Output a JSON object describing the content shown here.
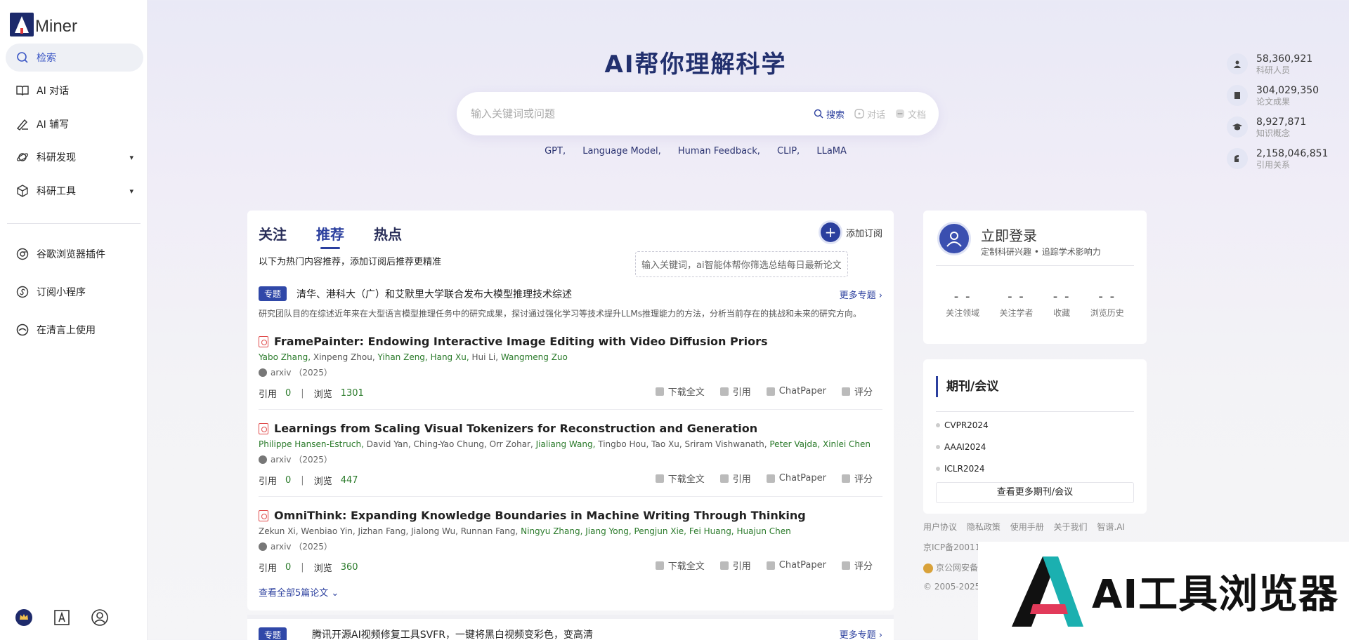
{
  "app": {
    "logo_text": "Miner"
  },
  "sidebar": {
    "items": [
      {
        "label": "检索"
      },
      {
        "label": "AI 对话"
      },
      {
        "label": "AI 辅写"
      },
      {
        "label": "科研发现"
      },
      {
        "label": "科研工具"
      },
      {
        "label": "谷歌浏览器插件"
      },
      {
        "label": "订阅小程序"
      },
      {
        "label": "在清言上使用"
      }
    ]
  },
  "hero": {
    "title": "AI帮你理解科学",
    "search_placeholder": "输入关键词或问题",
    "modes": {
      "search": "搜索",
      "chat": "对话",
      "doc": "文档"
    },
    "tags": [
      "GPT,",
      "Language Model,",
      "Human Feedback,",
      "CLIP,",
      "LLaMA"
    ]
  },
  "stats": [
    {
      "value": "58,360,921",
      "label": "科研人员"
    },
    {
      "value": "304,029,350",
      "label": "论文成果"
    },
    {
      "value": "8,927,871",
      "label": "知识概念"
    },
    {
      "value": "2,158,046,851",
      "label": "引用关系"
    }
  ],
  "feed": {
    "tabs": [
      "关注",
      "推荐",
      "热点"
    ],
    "subscribe_label": "添加订阅",
    "hint": "以下为热门内容推荐，添加订阅后推荐更精准",
    "tooltip": "输入关键词，ai智能体帮你筛选总结每日最新论文",
    "topic": {
      "badge": "专题",
      "title": "清华、港科大（广）和艾默里大学联合发布大模型推理技术综述",
      "more": "更多专题 ›",
      "desc": "研究团队目的在综述近年来在大型语言模型推理任务中的研究成果，探讨通过强化学习等技术提升LLMs推理能力的方法，分析当前存在的挑战和未来的研究方向。"
    },
    "labels": {
      "cite": "引用",
      "view": "浏览",
      "sep": "|",
      "download": "下载全文",
      "quote": "引用",
      "chatpaper": "ChatPaper",
      "rate": "评分"
    },
    "papers": [
      {
        "title": "FramePainter: Endowing Interactive Image Editing with Video Diffusion Priors",
        "authors": [
          {
            "name": "Yabo Zhang,",
            "hl": true
          },
          {
            "name": "Xinpeng Zhou,",
            "hl": false
          },
          {
            "name": "Yihan Zeng,",
            "hl": true
          },
          {
            "name": "Hang Xu,",
            "hl": true
          },
          {
            "name": "Hui Li,",
            "hl": false
          },
          {
            "name": "Wangmeng Zuo",
            "hl": true
          }
        ],
        "venue": "arxiv （2025）",
        "citations": "0",
        "views": "1301"
      },
      {
        "title": "Learnings from Scaling Visual Tokenizers for Reconstruction and Generation",
        "authors": [
          {
            "name": "Philippe Hansen-Estruch,",
            "hl": true
          },
          {
            "name": "David Yan,",
            "hl": false
          },
          {
            "name": "Ching-Yao Chung,",
            "hl": false
          },
          {
            "name": "Orr Zohar,",
            "hl": false
          },
          {
            "name": "Jialiang Wang,",
            "hl": true
          },
          {
            "name": "Tingbo Hou,",
            "hl": false
          },
          {
            "name": "Tao Xu,",
            "hl": false
          },
          {
            "name": "Sriram Vishwanath,",
            "hl": false
          },
          {
            "name": "Peter Vajda,",
            "hl": true
          },
          {
            "name": "Xinlei Chen",
            "hl": true
          }
        ],
        "venue": "arxiv （2025）",
        "citations": "0",
        "views": "447"
      },
      {
        "title": "OmniThink: Expanding Knowledge Boundaries in Machine Writing Through Thinking",
        "authors": [
          {
            "name": "Zekun Xi,",
            "hl": false
          },
          {
            "name": "Wenbiao Yin,",
            "hl": false
          },
          {
            "name": "Jizhan Fang,",
            "hl": false
          },
          {
            "name": "Jialong Wu,",
            "hl": false
          },
          {
            "name": "Runnan Fang,",
            "hl": false
          },
          {
            "name": "Ningyu Zhang,",
            "hl": true
          },
          {
            "name": "Jiang Yong,",
            "hl": true
          },
          {
            "name": "Pengjun Xie,",
            "hl": true
          },
          {
            "name": "Fei Huang,",
            "hl": true
          },
          {
            "name": "Huajun Chen",
            "hl": true
          }
        ],
        "venue": "arxiv （2025）",
        "citations": "0",
        "views": "360"
      }
    ],
    "view_all": "查看全部5篇论文",
    "next_topic": {
      "badge": "专题",
      "title": "腾讯开源AI视频修复工具SVFR，一键将黑白视频变彩色，变高清",
      "more": "更多专题 ›"
    }
  },
  "login": {
    "title": "立即登录",
    "subtitle": "定制科研兴趣 • 追踪学术影响力",
    "stats": [
      {
        "value": "- -",
        "label": "关注领域"
      },
      {
        "value": "- -",
        "label": "关注学者"
      },
      {
        "value": "- -",
        "label": "收藏"
      },
      {
        "value": "- -",
        "label": "浏览历史"
      }
    ]
  },
  "journals": {
    "title": "期刊/会议",
    "items": [
      "CVPR2024",
      "AAAI2024",
      "ICLR2024"
    ],
    "more": "查看更多期刊/会议"
  },
  "footer": {
    "links": [
      "用户协议",
      "隐私政策",
      "使用手册",
      "关于我们",
      "智谱.AI"
    ],
    "icp": "京ICP备20011824号-11",
    "police": "京公网安备",
    "copyright": "© 2005-2025 AMiner"
  },
  "watermark": {
    "text": "AI工具浏览器"
  },
  "colors": {
    "accent": "#2b3f9e",
    "author_highlight": "#2a7a2a",
    "badge": "#3048a8"
  }
}
